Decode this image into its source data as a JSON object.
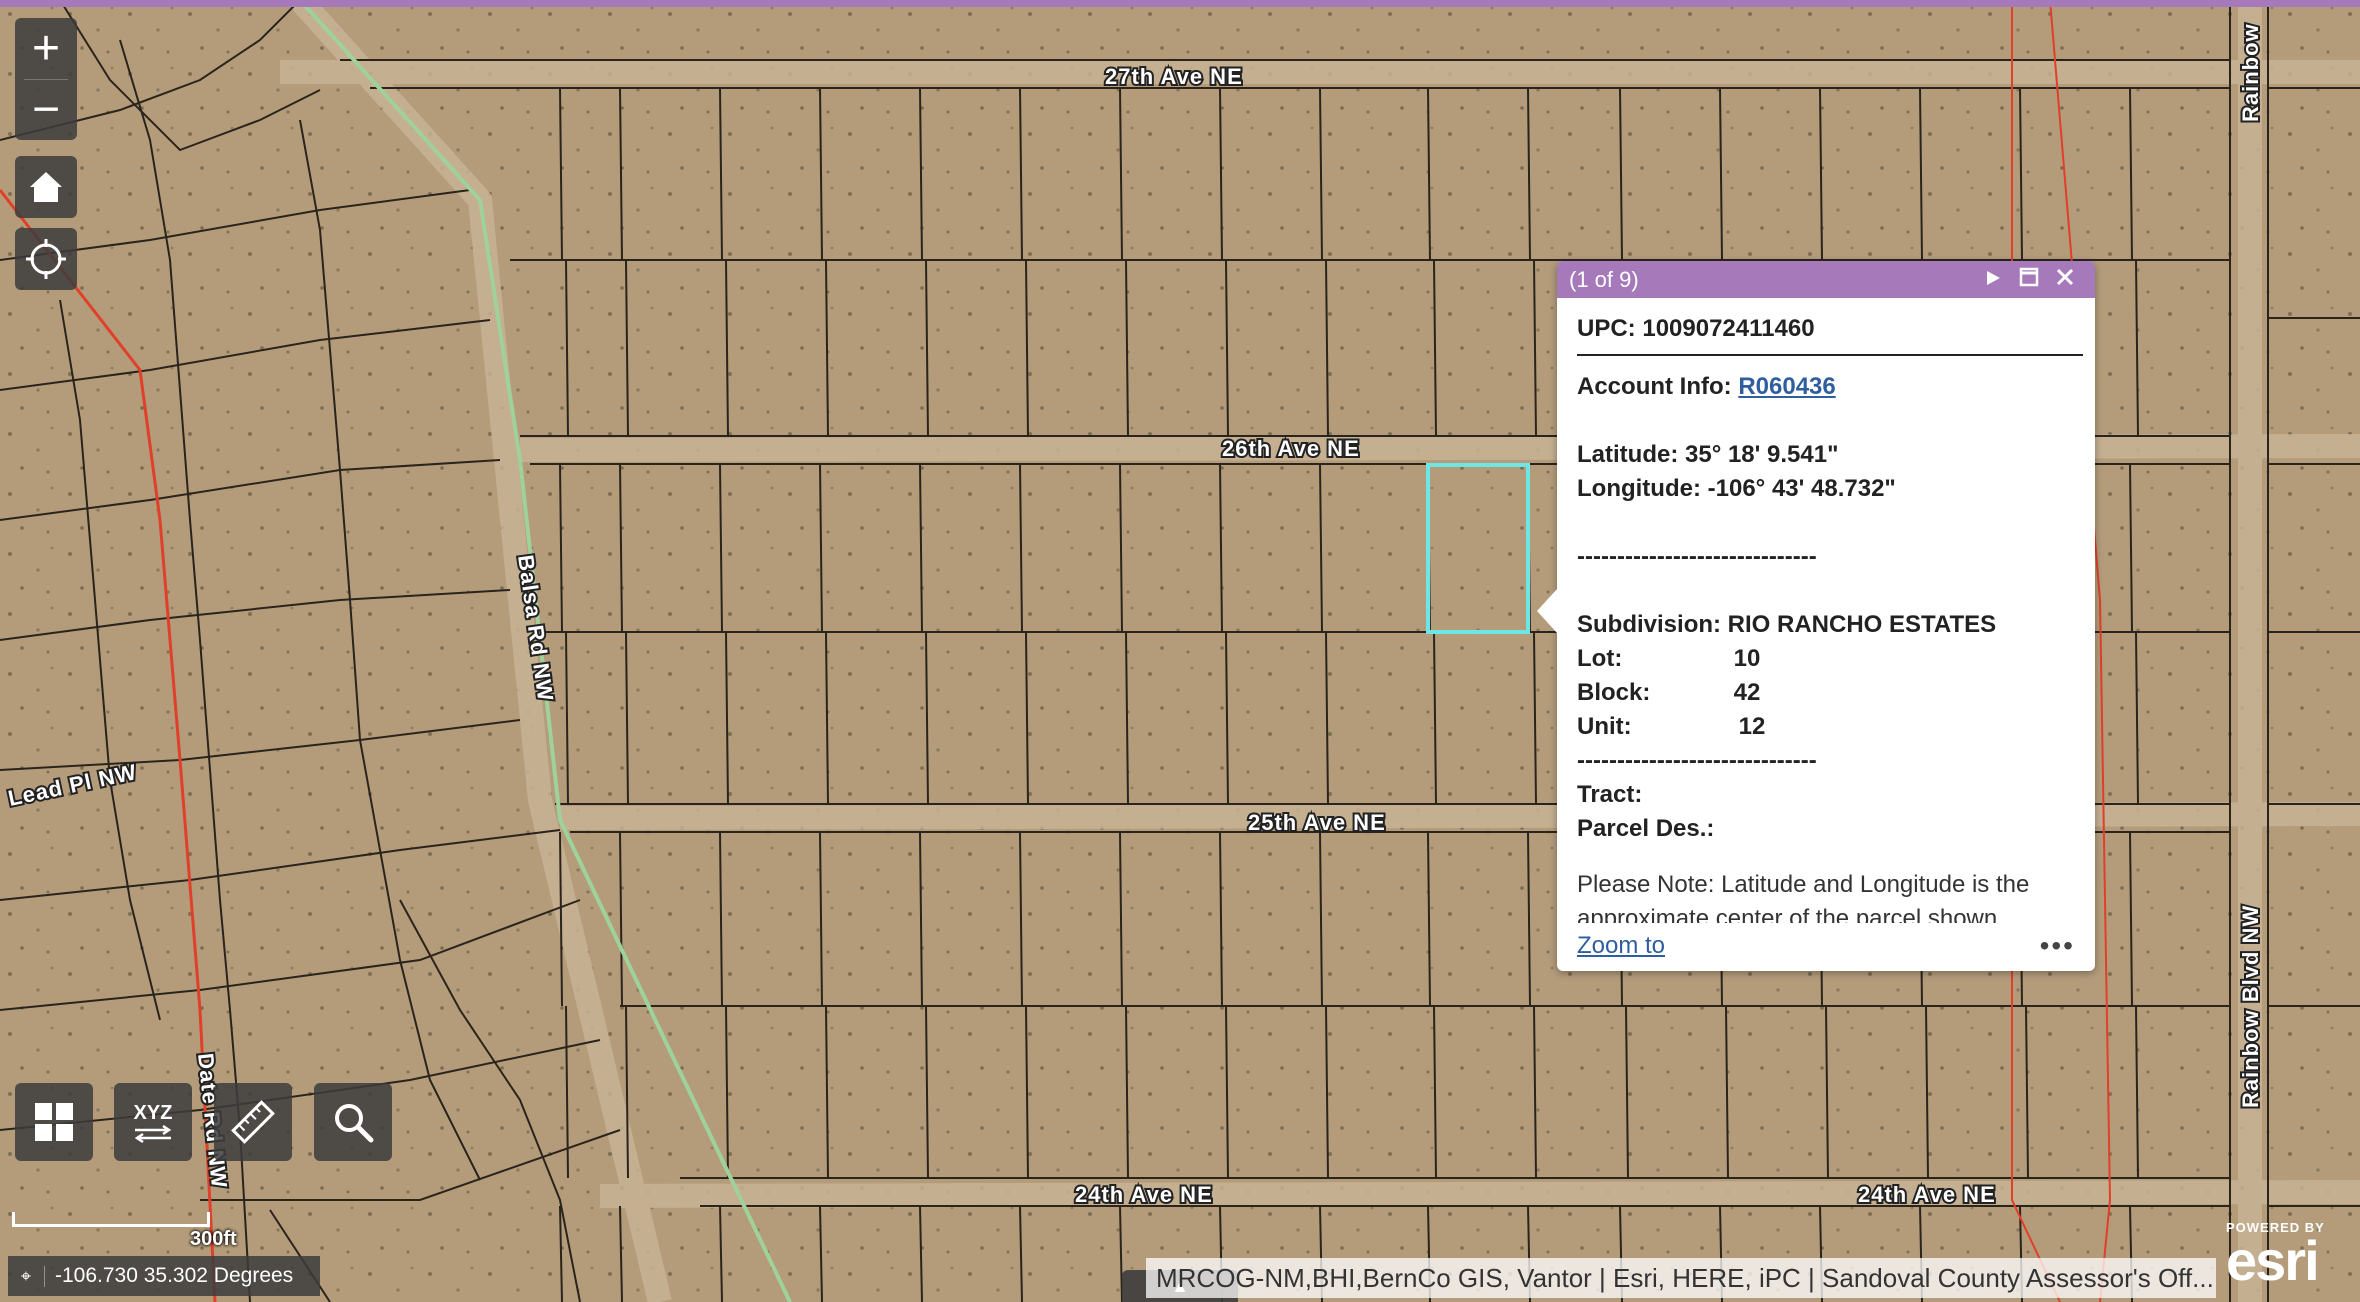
{
  "map": {
    "streets": [
      {
        "label": "27th Ave NE"
      },
      {
        "label": "26th Ave NE"
      },
      {
        "label": "25th Ave NE"
      },
      {
        "label": "24th Ave NE"
      },
      {
        "label": "24th Ave NE"
      },
      {
        "label": "Lead Pl NW"
      },
      {
        "label": "Balsa Rd NW"
      },
      {
        "label": "Date Rd NW"
      },
      {
        "label": "Rainbow Blvd NW"
      },
      {
        "label": "Rainbow"
      }
    ],
    "colors": {
      "ground": "#b39a78",
      "parcel_line": "#2a241c",
      "road_line": "#c9b497",
      "selected_parcel": "#6fe6e6",
      "red_boundary": "#e0402a",
      "green_road": "#9fd29a",
      "accent": "#a679bb"
    }
  },
  "controls": {
    "zoom_in": "+",
    "zoom_out": "−",
    "home_icon": "home-icon",
    "locate_icon": "locate-icon",
    "tools": [
      {
        "name": "basemap-gallery-button",
        "icon": "grid-icon"
      },
      {
        "name": "coordinate-conversion-button",
        "icon": "xyz-icon",
        "label": "XYZ"
      },
      {
        "name": "measure-button",
        "icon": "ruler-icon"
      },
      {
        "name": "search-button",
        "icon": "search-icon"
      }
    ]
  },
  "scalebar": {
    "label": "300ft"
  },
  "coordinates": {
    "text": "-106.730 35.302 Degrees"
  },
  "attribution": {
    "text": "MRCOG-NM,BHI,BernCo GIS, Vantor | Esri, HERE, iPC | Sandoval County Assessor's Off..."
  },
  "esri": {
    "powered_by": "POWERED BY",
    "logo": "esri"
  },
  "popup": {
    "count": "(1 of 9)",
    "upc_label": "UPC:",
    "upc_value": "1009072411460",
    "account_label": "Account Info:",
    "account_value": "R060436",
    "latitude_label": "Latitude:",
    "latitude_value": "35° 18' 9.541\"",
    "longitude_label": "Longitude:",
    "longitude_value": "-106° 43' 48.732\"",
    "divider": "------------------------------",
    "subdivision_label": "Subdivision:",
    "subdivision_value": "RIO RANCHO ESTATES",
    "lot_label": "Lot:",
    "lot_value": "10",
    "block_label": "Block:",
    "block_value": "42",
    "unit_label": "Unit:",
    "unit_value": "12",
    "tract_label": "Tract:",
    "parcel_des_label": "Parcel Des.:",
    "note": "Please Note: Latitude and Longitude is the approximate center of the parcel shown.",
    "zoom_to": "Zoom to",
    "more": "•••"
  }
}
